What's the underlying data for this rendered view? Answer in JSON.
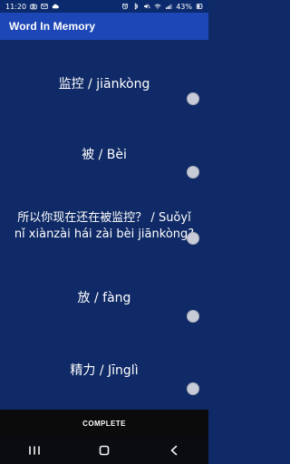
{
  "status_bar": {
    "time": "11:20",
    "battery": "43%"
  },
  "app_bar": {
    "title": "Word In Memory"
  },
  "words": [
    {
      "text": "监控 / jiānkòng"
    },
    {
      "text": "被 / Bèi"
    },
    {
      "text": "所以你现在还在被监控？ / Suǒyǐ nǐ xiànzài hái zài bèi jiānkòng?"
    },
    {
      "text": "放 / fàng"
    },
    {
      "text": "精力 / Jīnglì"
    }
  ],
  "bottom": {
    "complete_label": "COMPLETE"
  },
  "icons": {
    "status_left": [
      "camera-icon",
      "mail-icon",
      "cloud-icon"
    ],
    "status_right": [
      "alarm-icon",
      "bluetooth-icon",
      "mute-icon",
      "wifi-icon",
      "signal-icon",
      "battery-icon"
    ],
    "nav": [
      "recents-icon",
      "home-icon",
      "back-icon"
    ]
  },
  "colors": {
    "status_bar_bg": "#0b2a6d",
    "app_bar_bg": "#1d47b6",
    "content_bg": "#0f2a66",
    "bottom_bar_bg": "#0b0b0b",
    "toggle_off": "#c7ccd8",
    "text": "#ffffff"
  }
}
